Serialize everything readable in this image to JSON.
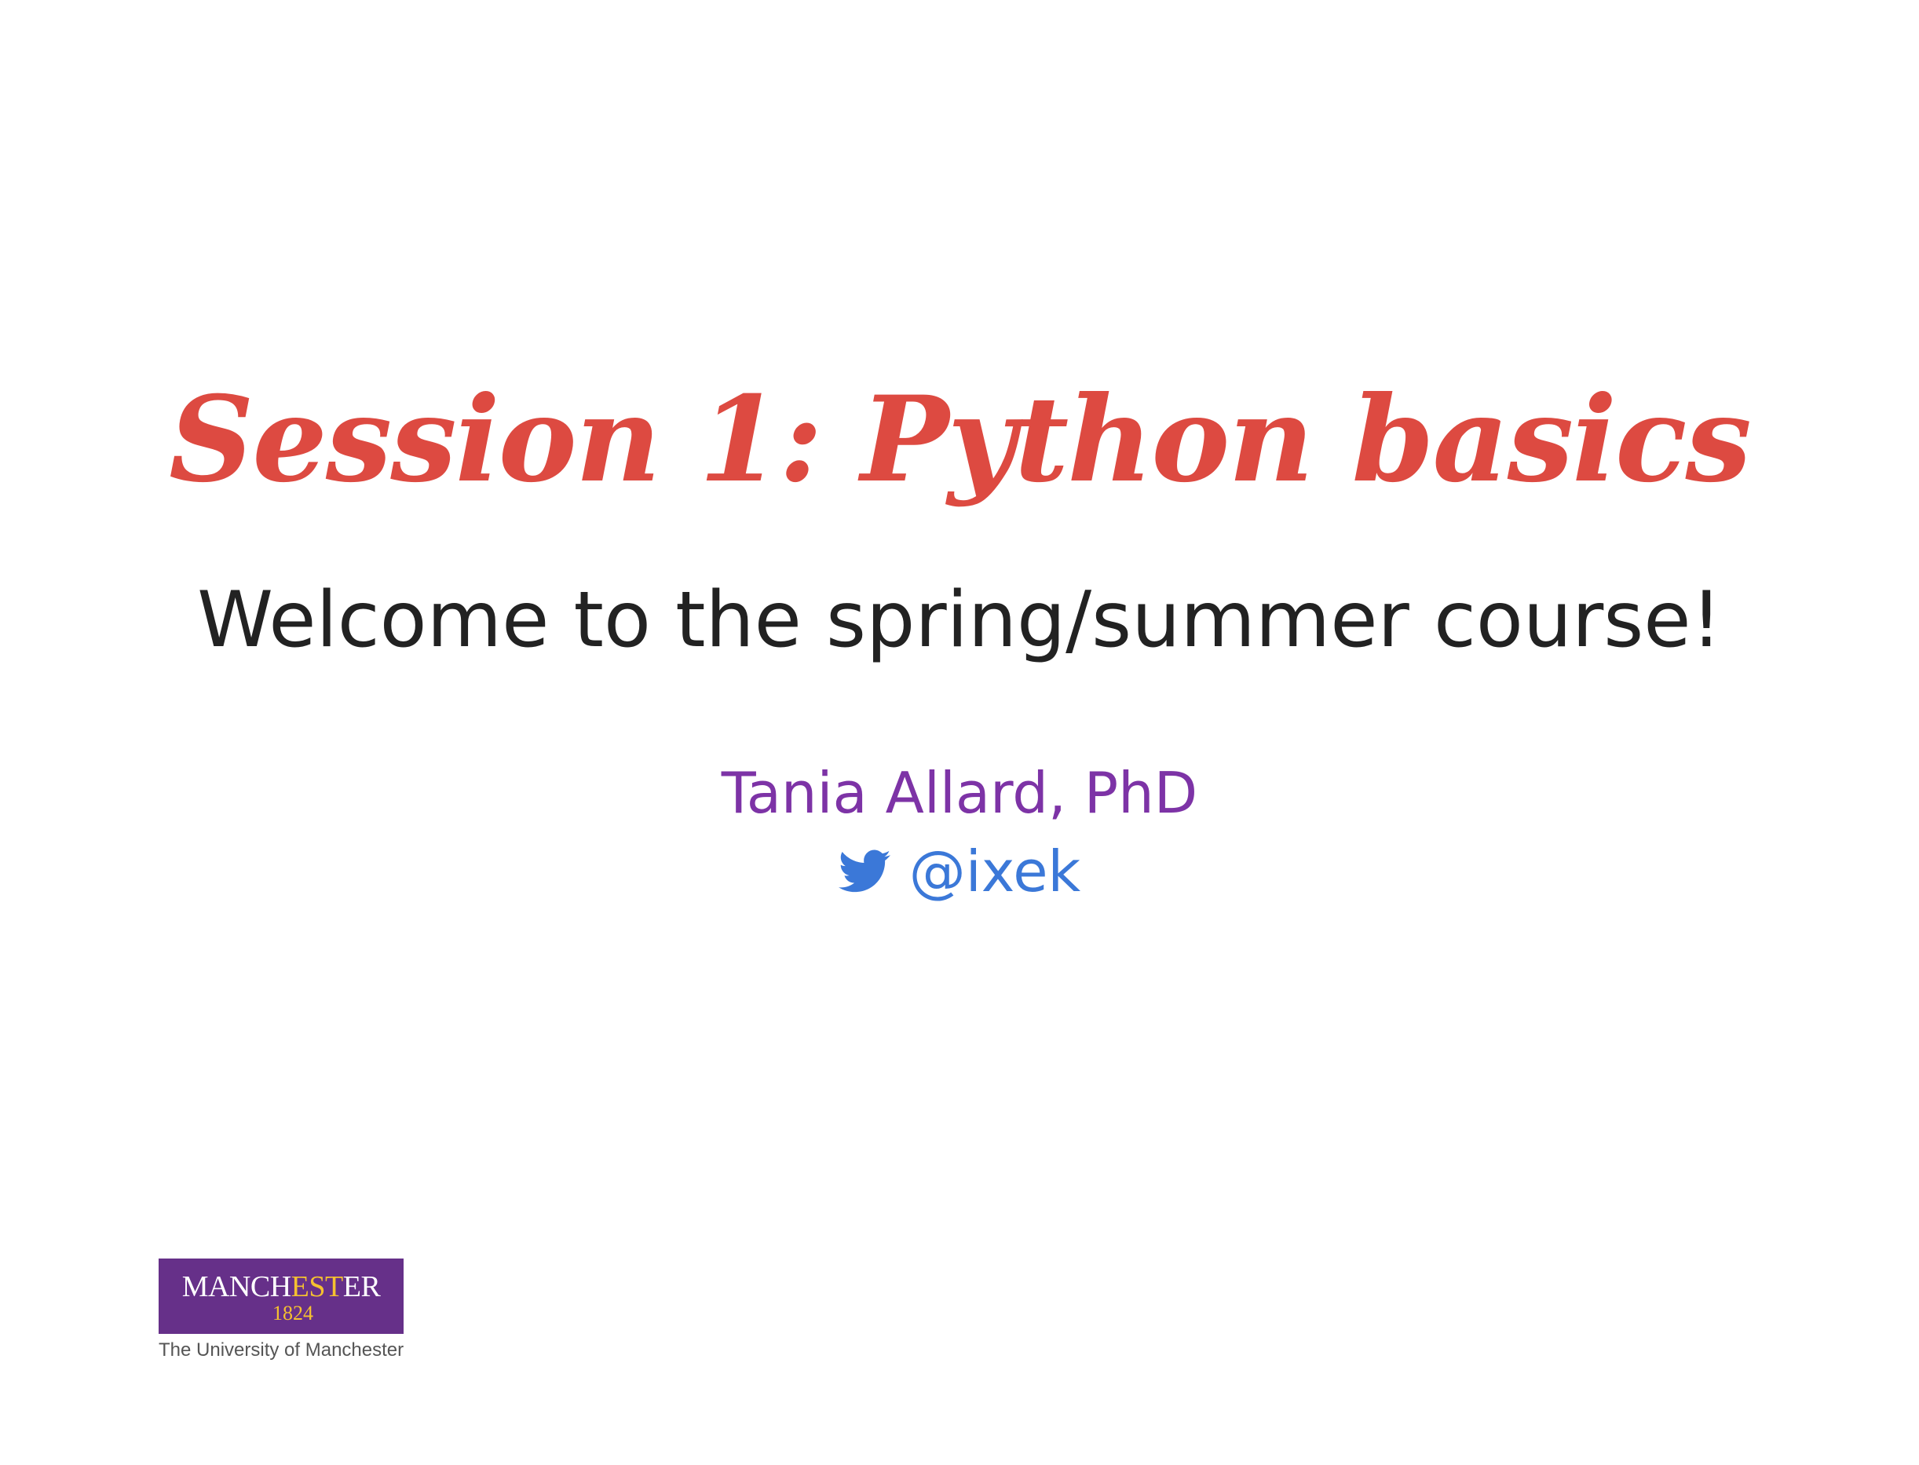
{
  "slide": {
    "title": "Session 1: Python basics",
    "subtitle": "Welcome to the spring/summer course!",
    "author": "Tania Allard, PhD",
    "social": {
      "icon": "twitter-bird-icon",
      "handle": "@ixek"
    }
  },
  "logo": {
    "word_part1": "MANCH",
    "word_part2": "EST",
    "word_part3": "ER",
    "year": "1824",
    "caption": "The University of Manchester"
  },
  "colors": {
    "title": "#dd4a41",
    "subtitle": "#222222",
    "author": "#7d33a6",
    "handle": "#3b78d8",
    "logo_purple": "#663089",
    "logo_gold": "#f5c130"
  }
}
